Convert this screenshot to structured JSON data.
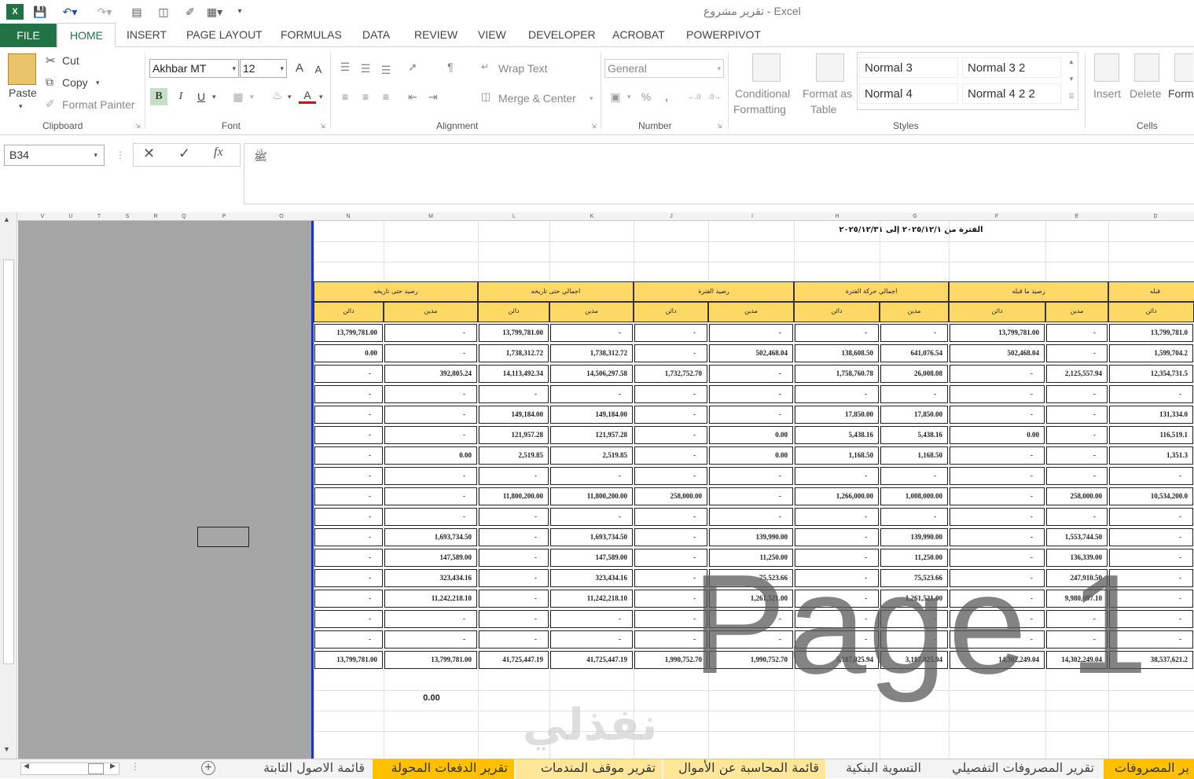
{
  "window": {
    "title": "تقرير مشروع - Excel"
  },
  "tabs": {
    "file": "FILE",
    "home": "HOME",
    "insert": "INSERT",
    "page_layout": "PAGE LAYOUT",
    "formulas": "FORMULAS",
    "data": "DATA",
    "review": "REVIEW",
    "view": "VIEW",
    "developer": "DEVELOPER",
    "acrobat": "ACROBAT",
    "powerpivot": "POWERPIVOT"
  },
  "clipboard": {
    "paste": "Paste",
    "cut": "Cut",
    "copy": "Copy",
    "format_painter": "Format Painter",
    "label": "Clipboard"
  },
  "font": {
    "name": "Akhbar MT",
    "size": "12",
    "label": "Font",
    "bold": "B",
    "italic": "I",
    "underline": "U",
    "grow": "A",
    "shrink": "A",
    "color": "A"
  },
  "alignment": {
    "wrap_text": "Wrap Text",
    "merge_center": "Merge & Center",
    "label": "Alignment"
  },
  "number": {
    "format": "General",
    "percent": "%",
    "comma": ",",
    "label": "Number"
  },
  "styles": {
    "conditional": "Conditional",
    "formatting": "Formatting",
    "format_as": "Format as",
    "table": "Table",
    "cells": [
      "Normal 3",
      "Normal 3 2",
      "Normal 4",
      "Normal 4 2 2"
    ],
    "label": "Styles"
  },
  "cells_group": {
    "insert": "Insert",
    "delete": "Delete",
    "format": "Form",
    "label": "Cells"
  },
  "formula_bar": {
    "name_box": "B34",
    "fx": "fx",
    "content": "ﷺ"
  },
  "columns": [
    "V",
    "U",
    "T",
    "S",
    "R",
    "Q",
    "P",
    "O",
    "N",
    "M",
    "L",
    "K",
    "J",
    "I",
    "H",
    "G",
    "F",
    "E",
    "D"
  ],
  "report": {
    "period": "الفترة من ٢٠٢٥/١٢/١ إلى ٢٠٢٥/١٢/٣١",
    "groups": [
      "رصيد حتى تاريخه",
      "اجمالي حتى تاريخه",
      "رصيد الفترة",
      "اجمالي حركة الفترة",
      "رصيد ما قبله",
      "قبله"
    ],
    "debit": "مدين",
    "credit": "دائن",
    "rows": [
      [
        "13,799,781.00",
        "-",
        "13,799,781.00",
        "-",
        "-",
        "-",
        "-",
        "-",
        "13,799,781.00",
        "-",
        "13,799,781.0"
      ],
      [
        "0.00",
        "-",
        "1,738,312.72",
        "1,738,312.72",
        "-",
        "502,468.04",
        "138,608.50",
        "641,076.54",
        "502,468.04",
        "-",
        "1,599,704.2"
      ],
      [
        "-",
        "392,805.24",
        "14,113,492.34",
        "14,506,297.58",
        "1,732,752.70",
        "-",
        "1,758,760.78",
        "26,008.08",
        "-",
        "2,125,557.94",
        "12,354,731.5"
      ],
      [
        "-",
        "-",
        "-",
        "-",
        "-",
        "-",
        "-",
        "-",
        "-",
        "-",
        "-"
      ],
      [
        "-",
        "-",
        "149,184.00",
        "149,184.00",
        "-",
        "-",
        "17,850.00",
        "17,850.00",
        "-",
        "-",
        "131,334.0"
      ],
      [
        "-",
        "-",
        "121,957.28",
        "121,957.28",
        "-",
        "0.00",
        "5,438.16",
        "5,438.16",
        "0.00",
        "-",
        "116,519.1"
      ],
      [
        "-",
        "0.00",
        "2,519.85",
        "2,519.85",
        "-",
        "0.00",
        "1,168.50",
        "1,168.50",
        "-",
        "-",
        "1,351.3"
      ],
      [
        "-",
        "-",
        "-",
        "-",
        "-",
        "-",
        "-",
        "-",
        "-",
        "-",
        "-"
      ],
      [
        "-",
        "-",
        "11,800,200.00",
        "11,800,200.00",
        "258,000.00",
        "-",
        "1,266,000.00",
        "1,008,000.00",
        "-",
        "258,000.00",
        "10,534,200.0"
      ],
      [
        "-",
        "-",
        "-",
        "-",
        "-",
        "-",
        "-",
        "-",
        "-",
        "-",
        "-"
      ],
      [
        "-",
        "1,693,734.50",
        "-",
        "1,693,734.50",
        "-",
        "139,990.00",
        "-",
        "139,990.00",
        "-",
        "1,553,744.50",
        "-"
      ],
      [
        "-",
        "147,589.00",
        "-",
        "147,589.00",
        "-",
        "11,250.00",
        "-",
        "11,250.00",
        "-",
        "136,339.00",
        "-"
      ],
      [
        "-",
        "323,434.16",
        "-",
        "323,434.16",
        "-",
        "75,523.66",
        "-",
        "75,523.66",
        "-",
        "247,910.50",
        "-"
      ],
      [
        "-",
        "11,242,218.10",
        "-",
        "11,242,218.10",
        "-",
        "1,261,521.00",
        "-",
        "1,261,521.00",
        "-",
        "9,980,697.10",
        "-"
      ],
      [
        "-",
        "-",
        "-",
        "-",
        "-",
        "-",
        "-",
        "-",
        "-",
        "-",
        "-"
      ],
      [
        "-",
        "-",
        "-",
        "-",
        "-",
        "-",
        "-",
        "-",
        "-",
        "-",
        "-"
      ],
      [
        "13,799,781.00",
        "13,799,781.00",
        "41,725,447.19",
        "41,725,447.19",
        "1,990,752.70",
        "1,990,752.70",
        "3,187,825.94",
        "3,187,825.94",
        "14,302,249.04",
        "14,302,249.04",
        "38,537,621.2"
      ]
    ],
    "extra_value": "0.00"
  },
  "watermark": "Page 1",
  "watermark2": "نفذلي",
  "sheets": [
    "قائمة الاصول الثابتة",
    "تقرير الدفعات المحولة",
    "تقرير موقف المندمات",
    "قائمة المحاسبة عن الأموال",
    "التسوية البنكية",
    "تقرير المصروفات التفصيلي",
    "ير المصروفات"
  ]
}
